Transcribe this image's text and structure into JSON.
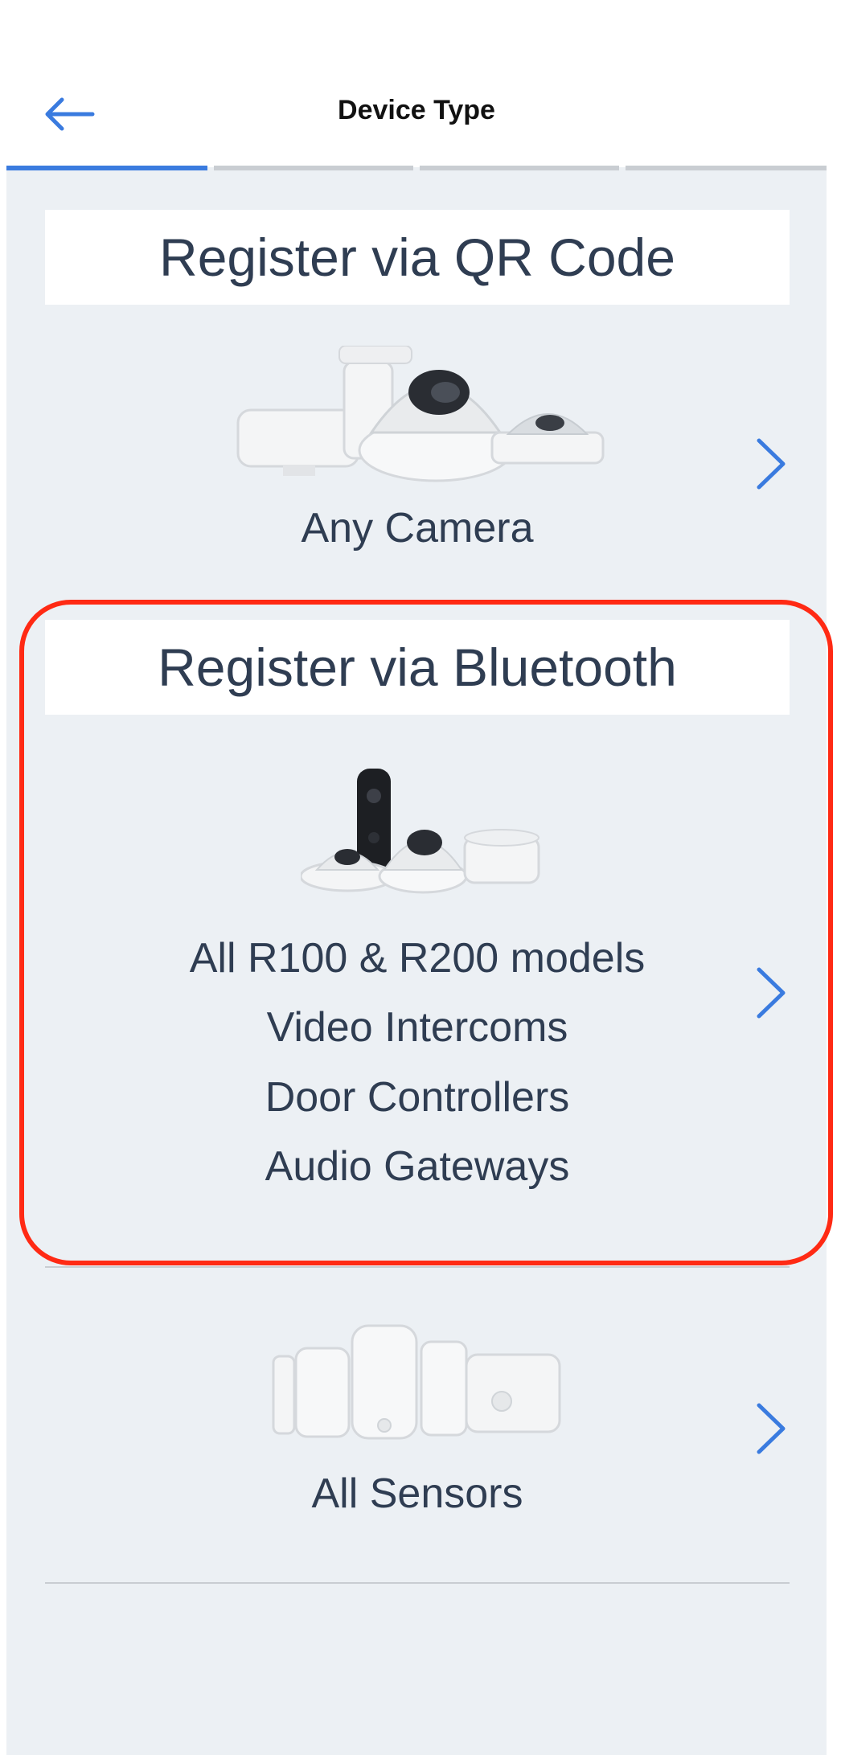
{
  "header": {
    "title": "Device Type",
    "back_icon": "arrow-left-icon",
    "progress_steps": [
      {
        "state": "active"
      },
      {
        "state": "inactive"
      },
      {
        "state": "inactive"
      },
      {
        "state": "inactive"
      }
    ]
  },
  "sections": {
    "qr": {
      "title": "Register via QR Code",
      "option": {
        "label": "Any Camera",
        "icon": "chevron-right-icon"
      }
    },
    "bluetooth": {
      "title": "Register via Bluetooth",
      "option": {
        "lines": [
          "All R100 & R200 models",
          "Video Intercoms",
          "Door Controllers",
          "Audio Gateways"
        ],
        "icon": "chevron-right-icon"
      }
    },
    "sensors": {
      "option": {
        "label": "All Sensors",
        "icon": "chevron-right-icon"
      }
    }
  },
  "colors": {
    "accent": "#3a7bdf",
    "text": "#2f3d52",
    "highlight": "#ff2a14",
    "progress_inactive": "#c9cdd2",
    "background": "#ecf0f4"
  }
}
